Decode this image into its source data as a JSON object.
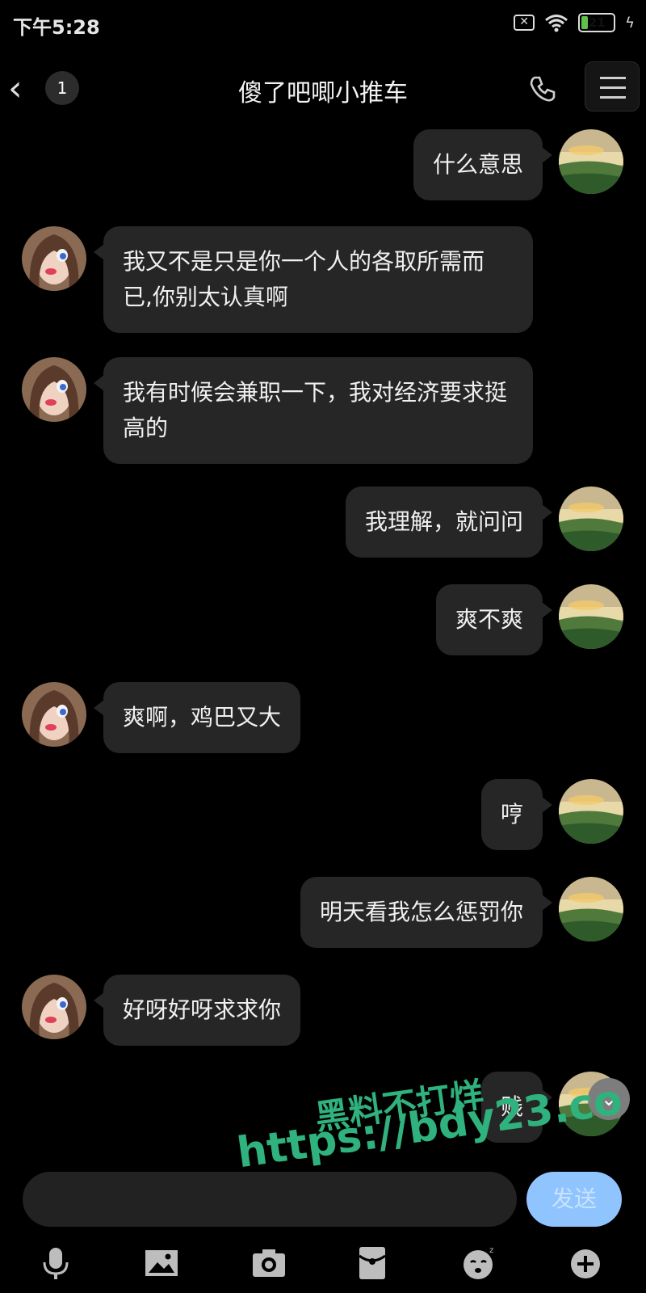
{
  "status_bar": {
    "time": "下午5:28",
    "sim_label": "✕",
    "battery_level": "21",
    "battery_percent": 0.21,
    "charging_symbol": "ϟ"
  },
  "header": {
    "back_symbol": "‹",
    "unread_count": "1",
    "title": "傻了吧唧小推车"
  },
  "messages": [
    {
      "side": "right",
      "text": "什么意思"
    },
    {
      "side": "left",
      "text": "我又不是只是你一个人的各取所需而已,你别太认真啊"
    },
    {
      "side": "left",
      "text": "我有时候会兼职一下，我对经济要求挺高的"
    },
    {
      "side": "right",
      "text": "我理解，就问问"
    },
    {
      "side": "right",
      "text": "爽不爽"
    },
    {
      "side": "left",
      "text": "爽啊，鸡巴又大"
    },
    {
      "side": "right",
      "text": "哼"
    },
    {
      "side": "right",
      "text": "明天看我怎么惩罚你"
    },
    {
      "side": "left",
      "text": "好呀好呀求求你"
    },
    {
      "side": "right",
      "text": "贱"
    }
  ],
  "scroll_down_symbol": "⌄",
  "watermark": {
    "line1": "黑料不打烊",
    "line2": "https://bdy23.co"
  },
  "input": {
    "placeholder": "",
    "value": "",
    "send_label": "发送"
  },
  "toolbar": {
    "icons": [
      "microphone-icon",
      "image-icon",
      "camera-icon",
      "red-packet-icon",
      "emoji-icon",
      "plus-icon"
    ]
  },
  "colors": {
    "background": "#000000",
    "bubble": "#262626",
    "send_button": "#8fc4ff",
    "watermark": "#2fb27d",
    "battery": "#5fc14b"
  }
}
